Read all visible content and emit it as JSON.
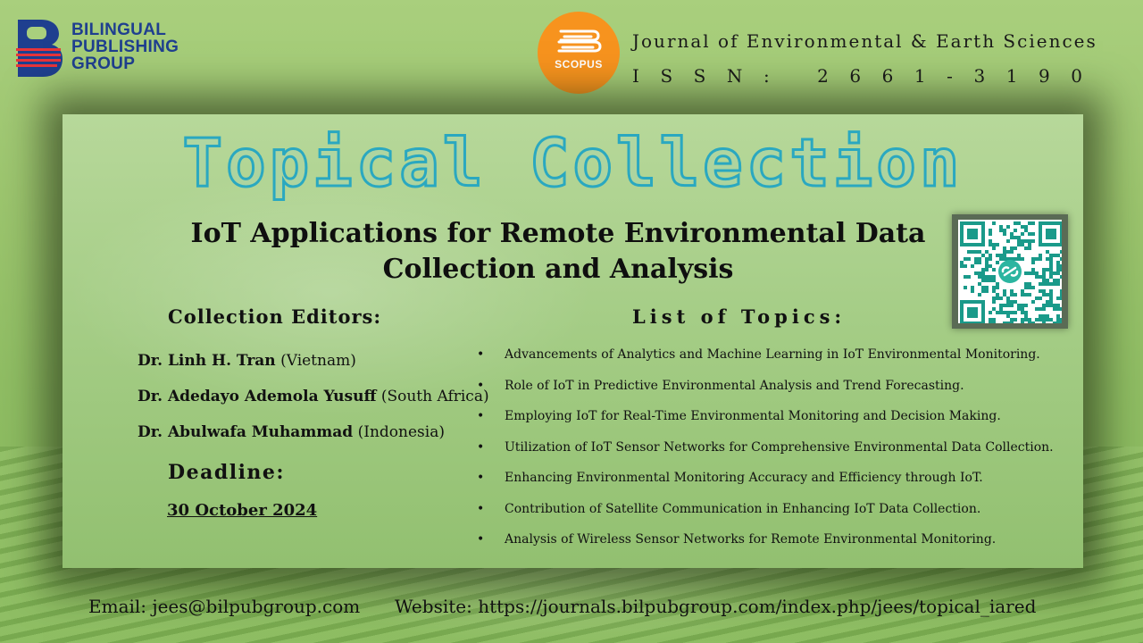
{
  "publisher": {
    "lines": [
      "BILINGUAL",
      "PUBLISHING",
      "GROUP"
    ],
    "brand_color": "#1f3f8f",
    "accent_color": "#e8343a"
  },
  "scopus": {
    "label": "SCOPUS",
    "color": "#f7931e"
  },
  "journal": {
    "name": "Journal of Environmental & Earth Sciences",
    "issn_chars": [
      "I",
      "S",
      "S",
      "N",
      ":",
      "2",
      "6",
      "6",
      "1",
      "-",
      "3",
      "1",
      "9",
      "0"
    ]
  },
  "title": "Topical Collection",
  "subtitle": "IoT Applications for Remote Environmental Data Collection and Analysis",
  "qr_code": {
    "icon": "link-icon"
  },
  "editors": {
    "heading": "Collection Editors:",
    "items": [
      {
        "name": "Dr. Linh H. Tran",
        "country": "(Vietnam)"
      },
      {
        "name": "Dr. Adedayo Ademola Yusuff",
        "country": "(South Africa)"
      },
      {
        "name": "Dr. Abulwafa Muhammad",
        "country": "(Indonesia)"
      }
    ]
  },
  "deadline": {
    "heading": "Deadline:",
    "date": "30 October 2024"
  },
  "topics": {
    "heading": "List of Topics:",
    "bullet": "•",
    "items": [
      "Advancements of Analytics and Machine Learning in IoT Environmental Monitoring.",
      "Role of IoT in Predictive Environmental Analysis and Trend Forecasting.",
      "Employing IoT for Real-Time Environmental Monitoring and Decision Making.",
      "Utilization of IoT Sensor Networks for Comprehensive Environmental Data Collection.",
      "Enhancing Environmental Monitoring Accuracy and Efficiency through IoT.",
      "Contribution of Satellite Communication in Enhancing IoT Data Collection.",
      "Analysis of Wireless Sensor Networks for Remote Environmental Monitoring."
    ]
  },
  "footer": {
    "email": "Email: jees@bilpubgroup.com",
    "website": "Website: https://journals.bilpubgroup.com/index.php/jees/topical_iared"
  }
}
